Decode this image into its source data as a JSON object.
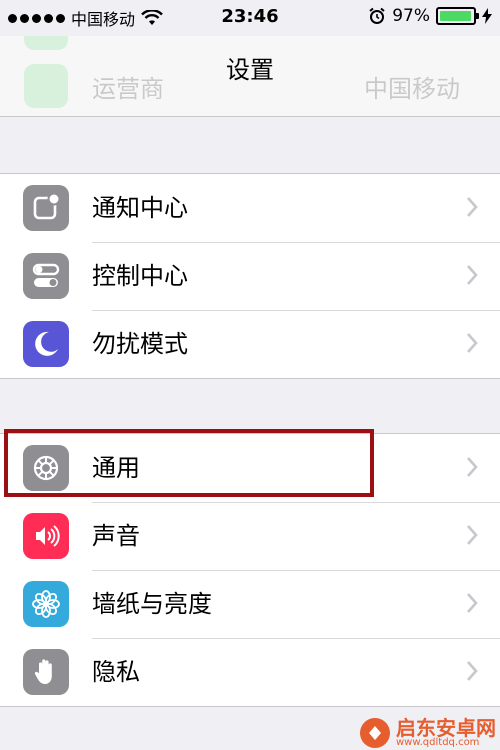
{
  "status_bar": {
    "carrier": "中国移动",
    "time": "23:46",
    "battery_percent": "97%",
    "battery_level": 0.97
  },
  "nav": {
    "title": "设置",
    "ghost_label": "运营商",
    "ghost_value": "中国移动"
  },
  "colors": {
    "green": "#4cd964",
    "gray_icon": "#8e8e93",
    "purple": "#5856d6",
    "red_pink": "#ff2d55",
    "teal": "#34aadc",
    "highlight": "#9c0f13"
  },
  "groups": [
    {
      "items": [
        {
          "label": "通知中心",
          "icon": "notification-center-icon"
        },
        {
          "label": "控制中心",
          "icon": "control-center-icon"
        },
        {
          "label": "勿扰模式",
          "icon": "moon-icon"
        }
      ]
    },
    {
      "items": [
        {
          "label": "通用",
          "icon": "gear-icon"
        },
        {
          "label": "声音",
          "icon": "speaker-icon"
        },
        {
          "label": "墙纸与亮度",
          "icon": "flower-icon"
        },
        {
          "label": "隐私",
          "icon": "hand-icon"
        }
      ]
    }
  ],
  "watermark": {
    "title": "启东安卓网",
    "url": "www.qdltdq.com"
  }
}
